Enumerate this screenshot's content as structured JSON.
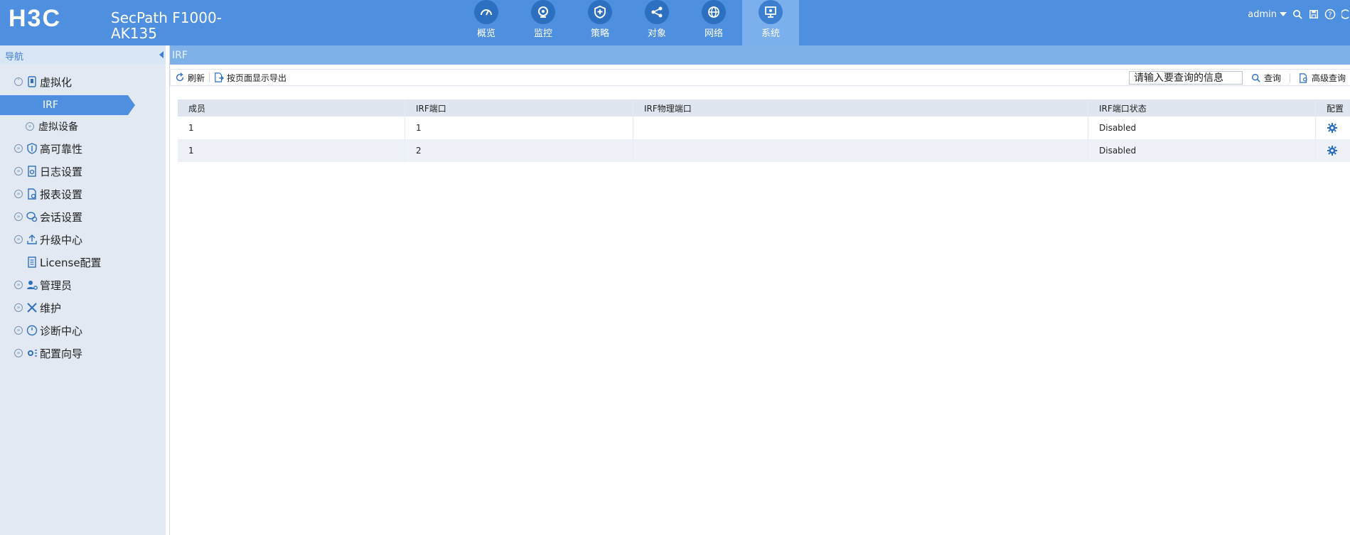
{
  "header": {
    "brand": "H3C",
    "product_line1": "SecPath F1000-",
    "product_line2": "AK135",
    "nav": [
      {
        "label": "概览",
        "icon": "dashboard-icon"
      },
      {
        "label": "监控",
        "icon": "camera-icon"
      },
      {
        "label": "策略",
        "icon": "shield-plus-icon"
      },
      {
        "label": "对象",
        "icon": "share-icon"
      },
      {
        "label": "网络",
        "icon": "globe-icon"
      },
      {
        "label": "系统",
        "icon": "monitor-icon",
        "active": true
      }
    ],
    "user": "admin"
  },
  "sidebar": {
    "title": "导航",
    "items": [
      {
        "label": "虚拟化",
        "expand": true
      },
      {
        "label": "IRF",
        "sub": true,
        "active": true
      },
      {
        "label": "虚拟设备",
        "sub": true
      },
      {
        "label": "高可靠性",
        "expand": true
      },
      {
        "label": "日志设置",
        "expand": true
      },
      {
        "label": "报表设置",
        "expand": true
      },
      {
        "label": "会话设置",
        "expand": true
      },
      {
        "label": "升级中心",
        "expand": true
      },
      {
        "label": "License配置",
        "expand": false
      },
      {
        "label": "管理员",
        "expand": true
      },
      {
        "label": "维护",
        "expand": true
      },
      {
        "label": "诊断中心",
        "expand": true
      },
      {
        "label": "配置向导",
        "expand": true
      }
    ]
  },
  "content": {
    "breadcrumb": "IRF",
    "toolbar": {
      "refresh": "刷新",
      "export": "按页面显示导出",
      "search_placeholder": "请输入要查询的信息",
      "search": "查询",
      "advanced": "高级查询"
    },
    "table": {
      "columns": [
        "成员",
        "IRF端口",
        "IRF物理端口",
        "IRF端口状态",
        "配置"
      ],
      "rows": [
        [
          "1",
          "1",
          "",
          "Disabled"
        ],
        [
          "1",
          "2",
          "",
          "Disabled"
        ]
      ]
    }
  },
  "colors": {
    "header_bg": "#4f8fdf",
    "accent": "#3b7fd6",
    "sidebar_bg": "#e3e9f2"
  }
}
